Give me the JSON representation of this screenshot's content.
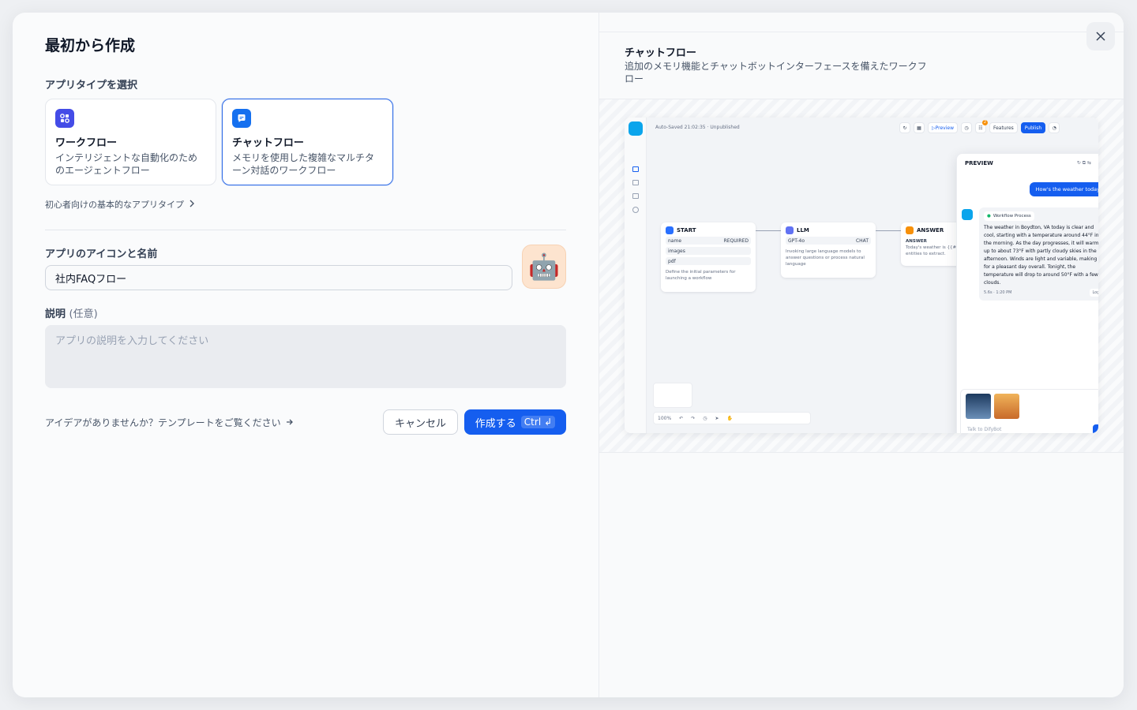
{
  "modal": {
    "title": "最初から作成",
    "app_type_label": "アプリタイプを選択",
    "app_types": [
      {
        "title": "ワークフロー",
        "desc": "インテリジェントな自動化のためのエージェントフロー",
        "icon": "workflow-icon",
        "color": "#444ce7",
        "selected": false
      },
      {
        "title": "チャットフロー",
        "desc": "メモリを使用した複雑なマルチターン対話のワークフロー",
        "icon": "chatflow-icon",
        "color": "#1570ef",
        "selected": true
      }
    ],
    "beginner_link": "初心者向けの基本的なアプリタイプ",
    "icon_name_label": "アプリのアイコンと名前",
    "name_value": "社内FAQフロー",
    "avatar_emoji": "🤖",
    "desc_label": "説明",
    "desc_optional": "(任意)",
    "desc_placeholder": "アプリの説明を入力してください",
    "idea_link": "アイデアがありませんか？テンプレートをご覧ください",
    "cancel_label": "キャンセル",
    "create_label": "作成する",
    "create_shortcut": "Ctrl",
    "create_shortcut_key": "↲"
  },
  "preview": {
    "title": "チャットフロー",
    "desc": "追加のメモリ機能とチャットボットインターフェースを備えたワークフロー",
    "app": {
      "autosave": "Auto-Saved 21:02:35 · Unpublished",
      "toolbar": {
        "preview": "Preview",
        "features": "Features",
        "publish": "Publish",
        "badge": "2"
      },
      "zoom": "100%",
      "nodes": {
        "start": {
          "title": "START",
          "vars": [
            {
              "name": "name",
              "tag": "REQUIRED"
            },
            {
              "name": "images",
              "tag": ""
            },
            {
              "name": "pdf",
              "tag": ""
            }
          ],
          "desc": "Define the initial parameters for launching a workflow"
        },
        "llm": {
          "title": "LLM",
          "model": "GPT-4o",
          "mode": "CHAT",
          "desc": "Invoking large language models to answer questions or process natural language"
        },
        "answer": {
          "title": "ANSWER",
          "label": "ANSWER",
          "text": "Today's weather is {{#",
          "text2": "entities to extract."
        }
      },
      "panel": {
        "title": "PREVIEW",
        "user_msg": "How's the weather today",
        "process": "Workflow Process",
        "bot_msg": "The weather in Boydton, VA today is clear and cool, starting with a temperature around 44°F in the morning. As the day progresses, it will warm up to about 73°F with partly cloudy skies in the afternoon. Winds are light and variable, making for a pleasant day overall. Tonight, the temperature will drop to around 50°F with a few clouds.",
        "meta": "5.6s · 1:20 PM",
        "logs": "Logs",
        "input_placeholder": "Talk to DifyBot"
      }
    }
  },
  "colors": {
    "accent": "#155eef",
    "selected_border": "#2e6be6"
  }
}
